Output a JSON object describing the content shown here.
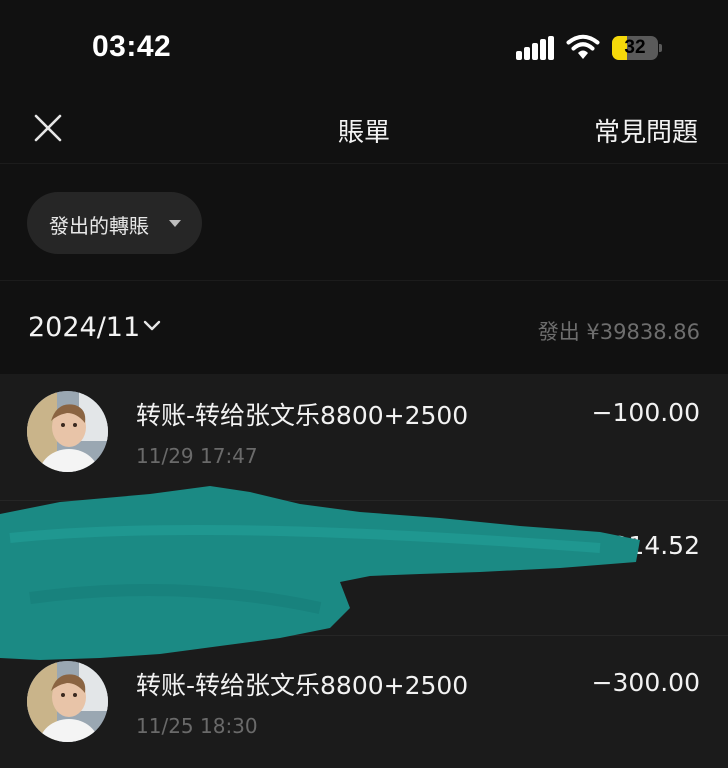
{
  "status_bar": {
    "time": "03:42",
    "battery_level": "32",
    "icons": [
      "cellular-signal-icon",
      "wifi-icon",
      "battery-icon"
    ]
  },
  "nav": {
    "title": "賬單",
    "faq_label": "常見問題",
    "close_icon": "close-icon"
  },
  "filter": {
    "label": "發出的轉賬",
    "icon": "caret-down-icon"
  },
  "month": {
    "label": "2024/11",
    "total": "發出 ¥39838.86",
    "icon": "chevron-down-icon"
  },
  "transactions": [
    {
      "title": "转账-转给张文乐8800+2500",
      "date": "11/29 17:47",
      "amount": "−100.00"
    },
    {
      "title": "",
      "date": "",
      "amount": "1314.52"
    },
    {
      "title": "转账-转给张文乐8800+2500",
      "date": "11/25 18:30",
      "amount": "−300.00"
    }
  ],
  "colors": {
    "background": "#111111",
    "list_background": "#1b1b1b",
    "chip": "#262626",
    "battery_fill": "#f5d90a",
    "redaction": "#1b8a84"
  }
}
